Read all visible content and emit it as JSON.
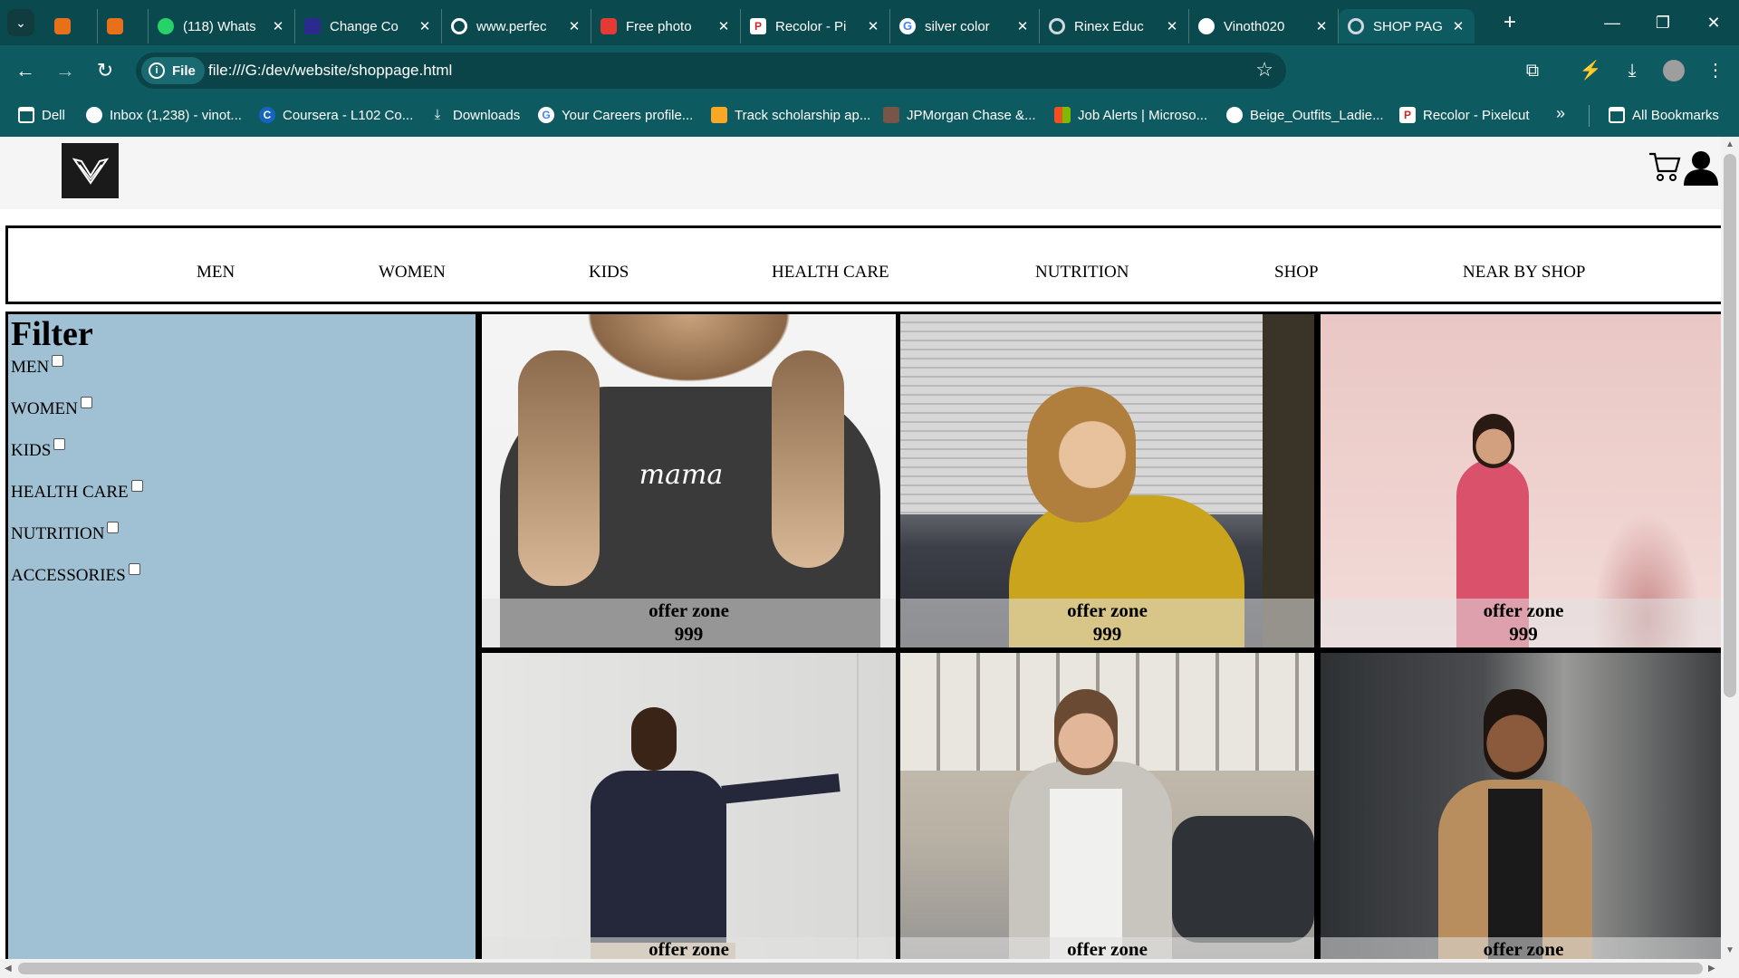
{
  "browser": {
    "tabs": [
      {
        "label": "",
        "favicon_color": "#e8701a"
      },
      {
        "label": "",
        "favicon_color": "#e8701a"
      },
      {
        "label": "(118) Whats",
        "favicon_color": "#25d366"
      },
      {
        "label": "Change Co",
        "favicon_color": "#2b2b8f"
      },
      {
        "label": "www.perfec",
        "favicon_color": "#5f6368"
      },
      {
        "label": "Free photo",
        "favicon_color": "#e53935"
      },
      {
        "label": "Recolor - Pi",
        "favicon_color": "#ffffff"
      },
      {
        "label": "silver color",
        "favicon_color": "#ffffff"
      },
      {
        "label": "Rinex Educ",
        "favicon_color": "#5f6368"
      },
      {
        "label": "Vinoth020",
        "favicon_color": "#ffffff"
      },
      {
        "label": "SHOP PAGE",
        "favicon_color": "#5f6368",
        "active": true
      }
    ],
    "address": {
      "chip": "File",
      "url": "file:///G:/dev/website/shoppage.html"
    },
    "bookmarks": [
      {
        "label": "Dell"
      },
      {
        "label": "Inbox (1,238) - vinot..."
      },
      {
        "label": "Coursera - L102 Co..."
      },
      {
        "label": "Downloads"
      },
      {
        "label": "Your Careers profile..."
      },
      {
        "label": "Track scholarship ap..."
      },
      {
        "label": "JPMorgan Chase &..."
      },
      {
        "label": "Job Alerts | Microso..."
      },
      {
        "label": "Beige_Outfits_Ladie..."
      },
      {
        "label": "Recolor - Pixelcut"
      }
    ],
    "more_bookmarks": "»",
    "all_bookmarks": "All Bookmarks",
    "colors": {
      "chrome": "#0d5a60",
      "tabstrip": "#0a4a4f"
    }
  },
  "site": {
    "nav": [
      "MEN",
      "WOMEN",
      "KIDS",
      "HEALTH CARE",
      "NUTRITION",
      "SHOP",
      "NEAR BY SHOP"
    ],
    "filter": {
      "title": "Filter",
      "options": [
        "MEN",
        "WOMEN",
        "KIDS",
        "HEALTH CARE",
        "NUTRITION",
        "ACCESSORIES"
      ]
    },
    "products": [
      {
        "title": "offer zone",
        "price": "999"
      },
      {
        "title": "offer zone",
        "price": "999"
      },
      {
        "title": "offer zone",
        "price": "999"
      },
      {
        "title": "offer zone",
        "price": ""
      },
      {
        "title": "offer zone",
        "price": ""
      },
      {
        "title": "offer zone",
        "price": ""
      }
    ],
    "colors": {
      "filter_bg": "#9fc1d3",
      "header_bg": "#f5f5f5"
    }
  }
}
